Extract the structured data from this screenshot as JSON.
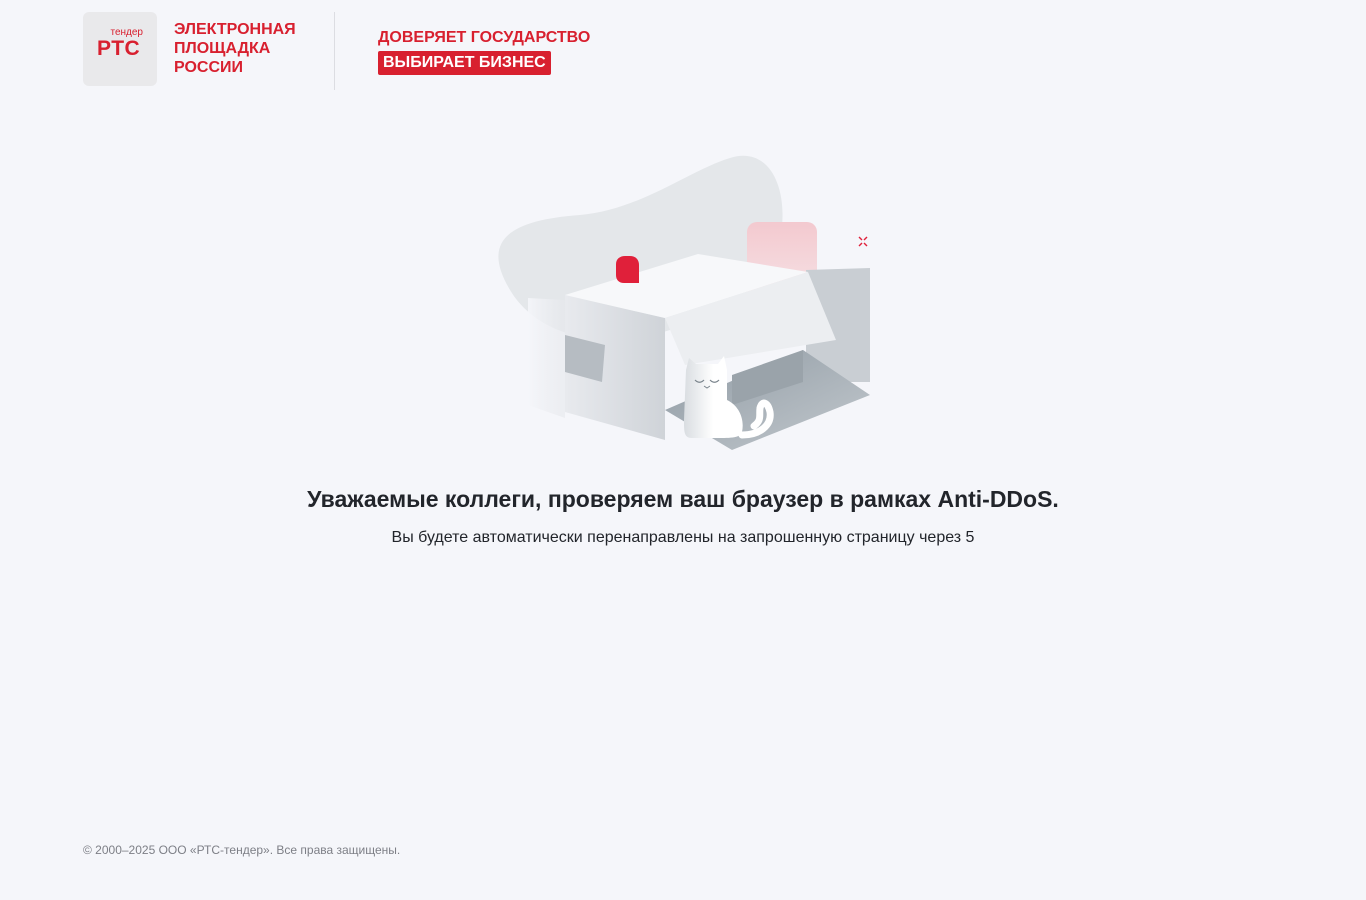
{
  "header": {
    "logo": {
      "small_text": "тендер",
      "big_text": "РТС"
    },
    "brand_text": "ЭЛЕКТРОННАЯ\nПЛОЩАДКА\nРОССИИ",
    "slogan": {
      "line1": "ДОВЕРЯЕТ ГОСУДАРСТВО",
      "line2": "ВЫБИРАЕТ БИЗНЕС"
    }
  },
  "main": {
    "illustration_icon": "cat-in-box-illustration",
    "title": "Уважаемые коллеги, проверяем ваш браузер в рамках Anti-DDoS.",
    "subtitle": "Вы будете автоматически перенаправлены на запрошенную страницу через 5"
  },
  "footer": {
    "copyright": "© 2000–2025 ООО «РТС-тендер». Все права защищены."
  },
  "colors": {
    "brand_red": "#d8202f",
    "background": "#f5f6fa",
    "text_dark": "#22252b",
    "text_muted": "#7d7f86"
  }
}
